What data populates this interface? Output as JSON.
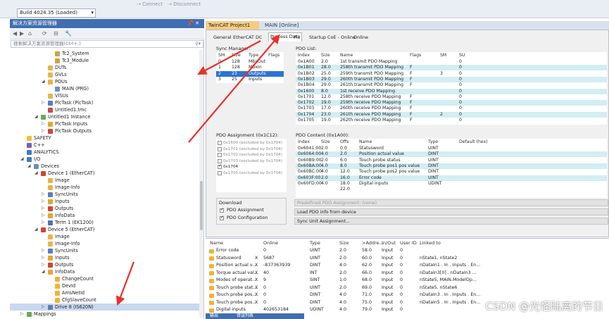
{
  "toolbar": {
    "build_combo": "Build 4024.35 (Loaded)",
    "connect": "Connect",
    "disconnect": "Disconnect"
  },
  "solution_explorer": {
    "title": "解决方案资源管理器",
    "search_placeholder": "搜索解决方案资源管理器(Ctrl+;)",
    "rows": [
      {
        "label": "Tc2_System",
        "indent": 4,
        "exp": "",
        "icon": "library-icon",
        "color": "#c9a24a"
      },
      {
        "label": "Tc3_Module",
        "indent": 4,
        "exp": "",
        "icon": "library-icon",
        "color": "#c9a24a"
      },
      {
        "label": "DUTs",
        "indent": 3,
        "exp": "",
        "icon": "folder-icon",
        "color": "#e8b44a"
      },
      {
        "label": "GVLs",
        "indent": 3,
        "exp": "",
        "icon": "folder-icon",
        "color": "#e8b44a"
      },
      {
        "label": "POUs",
        "indent": 3,
        "exp": "◢",
        "icon": "folder-icon",
        "color": "#e8b44a"
      },
      {
        "label": "MAIN (PRG)",
        "indent": 4,
        "exp": "",
        "icon": "program-icon",
        "color": "#6c8fbf"
      },
      {
        "label": "VISUs",
        "indent": 3,
        "exp": "",
        "icon": "folder-icon",
        "color": "#e8b44a"
      },
      {
        "label": "PlcTask (PlcTask)",
        "indent": 3,
        "exp": "▷",
        "icon": "task-icon",
        "color": "#4f7fc4"
      },
      {
        "label": "Untitled1.tmc",
        "indent": 3,
        "exp": "",
        "icon": "file-icon",
        "color": "#c94a4a"
      },
      {
        "label": "Untitled1 Instance",
        "indent": 2,
        "exp": "◢",
        "icon": "instance-icon",
        "color": "#6aa84f"
      },
      {
        "label": "PlcTask Inputs",
        "indent": 3,
        "exp": "▷",
        "icon": "inputs-icon",
        "color": "#e3a72f"
      },
      {
        "label": "PlcTask Outputs",
        "indent": 3,
        "exp": "▷",
        "icon": "outputs-icon",
        "color": "#d2452f"
      },
      {
        "label": "SAFETY",
        "indent": 0,
        "exp": "",
        "icon": "safety-icon",
        "color": "#f2c12e"
      },
      {
        "label": "C++",
        "indent": 0,
        "exp": "",
        "icon": "cpp-icon",
        "color": "#7a5cc2"
      },
      {
        "label": "ANALYTICS",
        "indent": 0,
        "exp": "",
        "icon": "analytics-icon",
        "color": "#3e7bc5"
      },
      {
        "label": "I/O",
        "indent": 0,
        "exp": "◢",
        "icon": "io-icon",
        "color": "#3e7bc5"
      },
      {
        "label": "Devices",
        "indent": 1,
        "exp": "◢",
        "icon": "devices-icon",
        "color": "#6b8fb8"
      },
      {
        "label": "Device 1 (EtherCAT)",
        "indent": 2,
        "exp": "◢",
        "icon": "ethercat-icon",
        "color": "#d2452f"
      },
      {
        "label": "Image",
        "indent": 3,
        "exp": "",
        "icon": "image-icon",
        "color": "#e8b44a"
      },
      {
        "label": "Image-Info",
        "indent": 3,
        "exp": "",
        "icon": "image-icon",
        "color": "#e8b44a"
      },
      {
        "label": "SyncUnits",
        "indent": 3,
        "exp": "▷",
        "icon": "syncunits-icon",
        "color": "#5a7fb5"
      },
      {
        "label": "Inputs",
        "indent": 3,
        "exp": "▷",
        "icon": "inputs-icon",
        "color": "#e3a72f"
      },
      {
        "label": "Outputs",
        "indent": 3,
        "exp": "▷",
        "icon": "outputs-icon",
        "color": "#d2452f"
      },
      {
        "label": "InfoData",
        "indent": 3,
        "exp": "▷",
        "icon": "infodata-icon",
        "color": "#e3a72f"
      },
      {
        "label": "Term 1 (EK1200)",
        "indent": 3,
        "exp": "▷",
        "icon": "terminal-icon",
        "color": "#4a74b5"
      },
      {
        "label": "Device 5 (EtherCAT)",
        "indent": 2,
        "exp": "◢",
        "icon": "ethercat-icon",
        "color": "#d2452f"
      },
      {
        "label": "Image",
        "indent": 3,
        "exp": "",
        "icon": "image-icon",
        "color": "#e8b44a"
      },
      {
        "label": "Image-Info",
        "indent": 3,
        "exp": "",
        "icon": "image-icon",
        "color": "#e8b44a"
      },
      {
        "label": "SyncUnits",
        "indent": 3,
        "exp": "▷",
        "icon": "syncunits-icon",
        "color": "#5a7fb5"
      },
      {
        "label": "Inputs",
        "indent": 3,
        "exp": "▷",
        "icon": "inputs-icon",
        "color": "#e3a72f"
      },
      {
        "label": "Outputs",
        "indent": 3,
        "exp": "▷",
        "icon": "outputs-icon",
        "color": "#d2452f"
      },
      {
        "label": "InfoData",
        "indent": 3,
        "exp": "◢",
        "icon": "infodata-icon",
        "color": "#e3a72f"
      },
      {
        "label": "ChangeCount",
        "indent": 4,
        "exp": "",
        "icon": "variable-icon",
        "color": "#f2b134"
      },
      {
        "label": "DevId",
        "indent": 4,
        "exp": "",
        "icon": "variable-icon",
        "color": "#f2b134"
      },
      {
        "label": "AmsNetId",
        "indent": 4,
        "exp": "",
        "icon": "variable-icon",
        "color": "#f2b134"
      },
      {
        "label": "CfgSlaveCount",
        "indent": 4,
        "exp": "",
        "icon": "variable-icon",
        "color": "#f2b134"
      },
      {
        "label": "Drive 8 (IS620N)",
        "indent": 3,
        "exp": "▷",
        "icon": "drive-icon",
        "color": "#5f7fa8",
        "selected": true
      },
      {
        "label": "Mappings",
        "indent": 0,
        "exp": "▷",
        "icon": "mappings-icon",
        "color": "#6aa84f"
      }
    ]
  },
  "doc_tabs": {
    "project": "TwinCAT Project1",
    "main": "MAIN [Online]"
  },
  "sub_tabs": [
    "General",
    "EtherCAT",
    "DC",
    "Process Data",
    "Plc",
    "Startup",
    "CoE - Online",
    "Online"
  ],
  "sync_manager": {
    "title": "Sync Manager:",
    "headers": [
      "SM",
      "Size",
      "Type",
      "Flags"
    ],
    "rows": [
      [
        "0",
        "128",
        "MbxOut",
        ""
      ],
      [
        "1",
        "128",
        "MbxIn",
        ""
      ],
      [
        "2",
        "23",
        "Outputs",
        ""
      ],
      [
        "3",
        "25",
        "Inputs",
        ""
      ]
    ],
    "selected_index": 2
  },
  "pdo_list": {
    "title": "PDO List:",
    "headers": [
      "Index",
      "Size",
      "Name",
      "Flags",
      "SM",
      "SU"
    ],
    "rows": [
      [
        "0x1A00",
        "2.0",
        "1st transmit PDO Mapping",
        "",
        "",
        "0"
      ],
      [
        "0x1B01",
        "28.0",
        "258th transmit PDO Mapping",
        "F",
        "",
        "0"
      ],
      [
        "0x1B02",
        "25.0",
        "259th transmit PDO Mapping",
        "F",
        "3",
        "0"
      ],
      [
        "0x1B03",
        "29.0",
        "260th transmit PDO Mapping",
        "F",
        "",
        "0"
      ],
      [
        "0x1B04",
        "29.0",
        "261th transmit PDO Mapping",
        "F",
        "",
        "0"
      ],
      [
        "0x1600",
        "8.0",
        "1st receive PDO Mapping",
        "",
        "",
        "0"
      ],
      [
        "0x1701",
        "12.0",
        "258th receive PDO Mapping",
        "F",
        "",
        "0"
      ],
      [
        "0x1702",
        "19.0",
        "259th receive PDO Mapping",
        "F",
        "",
        "0"
      ],
      [
        "0x1703",
        "17.0",
        "260th receive PDO Mapping",
        "F",
        "",
        "0"
      ],
      [
        "0x1704",
        "23.0",
        "261th receive PDO Mapping",
        "F",
        "2",
        "0"
      ],
      [
        "0x1705",
        "19.0",
        "262th receive PDO Mapping",
        "F",
        "",
        "0"
      ]
    ]
  },
  "pdo_assignment": {
    "title": "PDO Assignment (0x1C12):",
    "items": [
      {
        "label": "0x1600 (excluded by 0x1704)",
        "checked": false
      },
      {
        "label": "0x1701 (excluded by 0x1704)",
        "checked": false
      },
      {
        "label": "0x1702 (excluded by 0x1704)",
        "checked": false
      },
      {
        "label": "0x1703 (excluded by 0x1704)",
        "checked": false
      },
      {
        "label": "0x1704",
        "checked": true
      },
      {
        "label": "0x1705 (excluded by 0x1704)",
        "checked": false
      }
    ]
  },
  "download": {
    "title": "Download",
    "pdo_assignment": "PDO Assignment",
    "pdo_configuration": "PDO Configuration"
  },
  "pdo_content": {
    "title": "PDO Content (0x1A00):",
    "headers": [
      "Index",
      "Size",
      "Offs",
      "Name",
      "Type",
      "Default (hex)"
    ],
    "rows": [
      [
        "0x6041:00",
        "2.0",
        "0.0",
        "Statusword",
        "UINT",
        ""
      ],
      [
        "0x6064:00",
        "4.0",
        "2.0",
        "Position actual value",
        "DINT",
        ""
      ],
      [
        "0x60B9:00",
        "2.0",
        "6.0",
        "Touch probe status",
        "UINT",
        ""
      ],
      [
        "0x60BA:00",
        "4.0",
        "8.0",
        "Touch probe pos1 pos value",
        "DINT",
        ""
      ],
      [
        "0x60BC:00",
        "4.0",
        "12.0",
        "Touch probe pos2 pos value",
        "DINT",
        ""
      ],
      [
        "0x603F:00",
        "2.0",
        "16.0",
        "Error code",
        "UINT",
        ""
      ],
      [
        "0x60FD:00",
        "4.0",
        "18.0",
        "Digital inputs",
        "UDINT",
        ""
      ],
      [
        "",
        "",
        "22.0",
        "",
        "",
        ""
      ]
    ]
  },
  "actions": {
    "predefined": "Predefined PDO Assignment: (none)",
    "load": "Load PDO info from device",
    "sync_unit": "Sync Unit Assignment..."
  },
  "online_vars": {
    "headers": [
      "Name",
      "Online",
      "Type",
      "Size",
      ">Addre...",
      "In/Out",
      "User ID",
      "Linked to"
    ],
    "rows": [
      [
        "Error code",
        "",
        "0",
        "UINT",
        "2.0",
        "58.0",
        "Input",
        "0",
        ""
      ],
      [
        "Statusword",
        "X",
        "5687",
        "UINT",
        "2.0",
        "60.0",
        "Input",
        "0",
        "nState1, nState2"
      ],
      [
        "Position actual v...",
        "X",
        "-837363939",
        "DINT",
        "4.0",
        "62.0",
        "Input",
        "0",
        "nDataIn1 . In . Inputs . En..."
      ],
      [
        "Torque actual val...",
        "X",
        "40",
        "INT",
        "2.0",
        "66.0",
        "Input",
        "0",
        "nDataIn3[0] . nDataIn3 ..."
      ],
      [
        "Modes of operat...",
        "X",
        "9",
        "SINT",
        "1.0",
        "68.0",
        "Input",
        "0",
        "nState5, MAIN.ModelOp..."
      ],
      [
        "Touch probe stat...",
        "X",
        "0",
        "UINT",
        "2.0",
        "69.0",
        "Input",
        "0",
        "nState5, nState6"
      ],
      [
        "Touch probe pos...",
        "X",
        "0",
        "DINT",
        "4.0",
        "71.0",
        "Input",
        "0",
        "nDataIn3 . In . Inputs . En..."
      ],
      [
        "Touch probe pos...",
        "X",
        "0",
        "DINT",
        "4.0",
        "75.0",
        "Input",
        "0",
        "nDataIn5 . In . Inputs . En..."
      ],
      [
        "Digital inputs",
        "",
        "402653184",
        "UDINT",
        "4.0",
        "79.0",
        "Input",
        "0",
        ""
      ]
    ]
  },
  "bottom": {
    "tab1": "输出",
    "tab2": "错误列表"
  },
  "watermark": "CSDN @光怪陆离的节日",
  "colors": {
    "accent": "#3f6fb1",
    "active_tab": "#f5cc84",
    "selection": "#2c73d6",
    "highlight_row": "#d2eef3",
    "annotation_arrow": "#e8312a"
  }
}
